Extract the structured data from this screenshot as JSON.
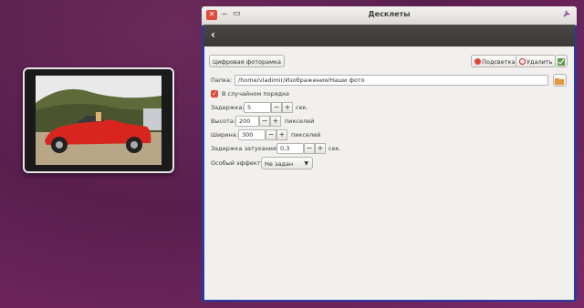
{
  "window": {
    "title": "Десклеты",
    "close_glyph": "×",
    "min_glyph": "‒",
    "max_glyph": "▭",
    "tool_icon": "wrench-icon",
    "back_glyph": "‹"
  },
  "toolbar": {
    "desklet_name": "Цифровая фоторамка",
    "highlight_label": "Подсветка",
    "remove_label": "Удалить",
    "accent_highlight": "#df4a3a",
    "accent_remove": "#cc2222"
  },
  "settings": {
    "folder_label": "Папка:",
    "folder_value": "/home/vladimir/Изображения/Наши фото",
    "random_label": "В случайном порядке",
    "random_checked": true,
    "delay_label": "Задержка:",
    "delay_value": "5",
    "delay_unit": "сек.",
    "height_label": "Высота:",
    "height_value": "200",
    "height_unit": "пикселей",
    "width_label": "Ширина:",
    "width_value": "300",
    "width_unit": "пикселей",
    "fade_label": "Задержка затухания:",
    "fade_value": "0,3",
    "fade_unit": "сек.",
    "effect_label": "Особый эффект:",
    "effect_value": "Не задан"
  },
  "stepper": {
    "minus": "−",
    "plus": "+"
  },
  "colors": {
    "desktop": "#6a2a5a",
    "window_border": "#2b3aa0",
    "headerbar": "#3f3d39"
  }
}
